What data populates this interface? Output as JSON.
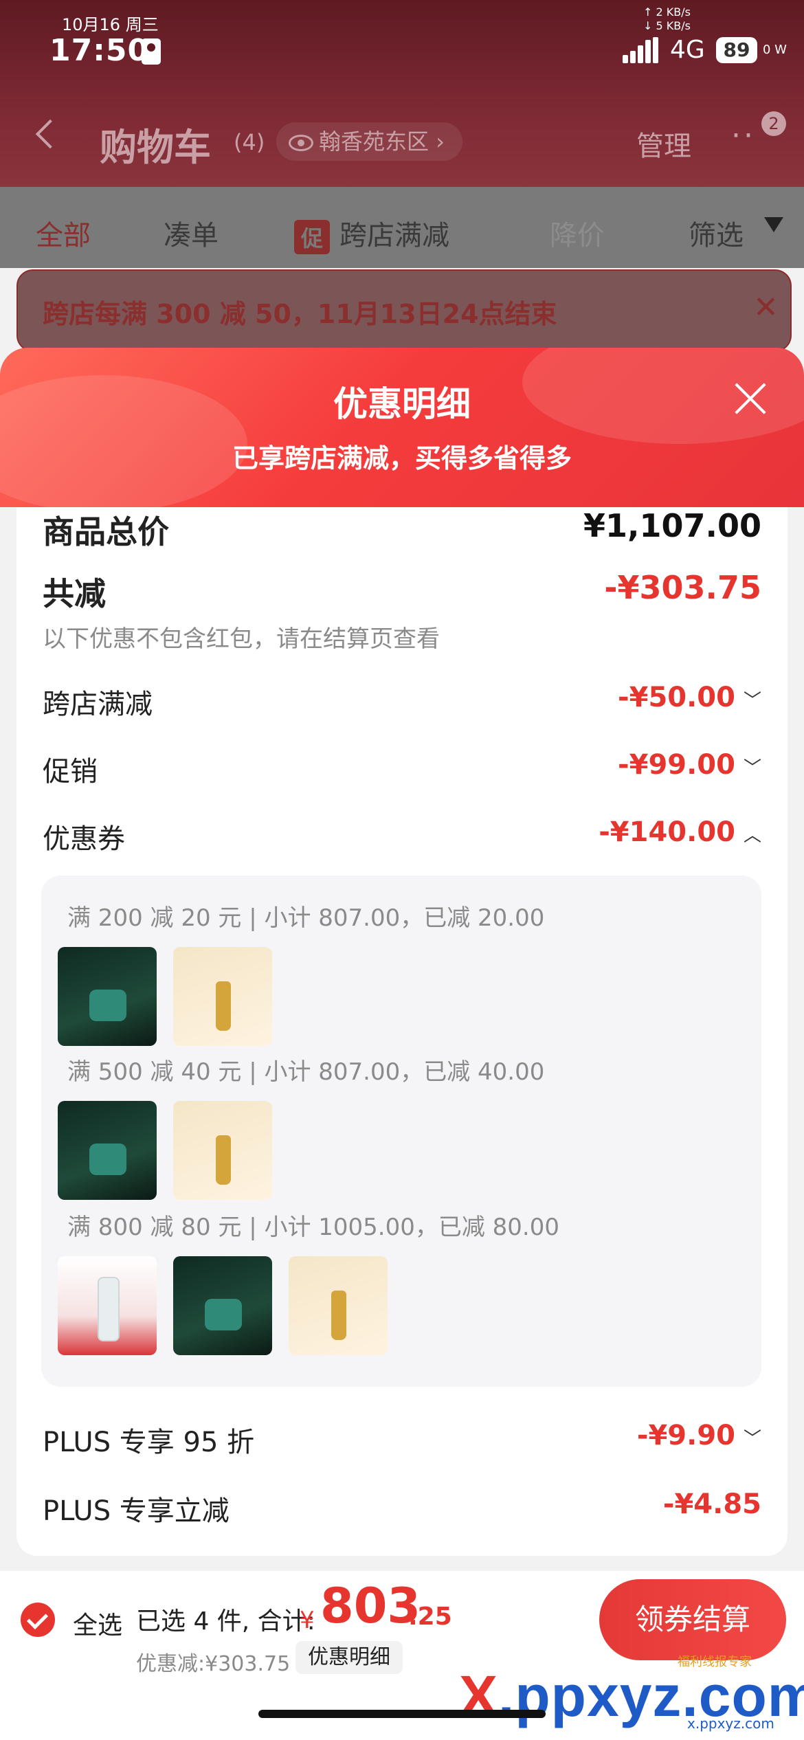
{
  "status_bar": {
    "date": "10月16 周三",
    "time": "17:50",
    "speed_up": "↑ 2 KB/s",
    "speed_down": "↓ 5 KB/s",
    "network": "4G",
    "battery": "89",
    "extra": "0 W"
  },
  "nav": {
    "title": "购物车",
    "count": "(4)",
    "location": "翰香苑东区",
    "manage": "管理",
    "badge": "2"
  },
  "tabs": {
    "all": "全部",
    "combine": "凑单",
    "promo_chip": "促",
    "cross_store": "跨店满减",
    "price_drop": "降价",
    "filter": "筛选"
  },
  "notice": {
    "text": "跨店每满 300 减 50，11月13日24点结束"
  },
  "sheet": {
    "title": "优惠明细",
    "subtitle": "已享跨店满减，买得多省得多",
    "total_label": "商品总价",
    "total_value": "¥1,107.00",
    "discount_label": "共减",
    "discount_value": "-¥303.75",
    "discount_note": "以下优惠不包含红包，请在结算页查看",
    "rows": [
      {
        "label": "跨店满减",
        "value": "-¥50.00"
      },
      {
        "label": "促销",
        "value": "-¥99.00"
      },
      {
        "label": "优惠券",
        "value": "-¥140.00"
      }
    ],
    "coupon_tiers": [
      {
        "text": "满 200 减 20 元 | 小计 807.00，已减 20.00"
      },
      {
        "text": "满 500 减 40 元 | 小计 807.00，已减 40.00"
      },
      {
        "text": "满 800 减 80 元 | 小计 1005.00，已减 80.00"
      }
    ],
    "plus_rows": [
      {
        "label": "PLUS 专享 95 折",
        "value": "-¥9.90"
      },
      {
        "label": "PLUS 专享立减",
        "value": "-¥4.85"
      }
    ]
  },
  "bottom": {
    "select_all": "全选",
    "selected_info": "已选 4 件, 合计:",
    "currency": "¥",
    "total_int": "803",
    "total_dec": ".25",
    "discount_line": "优惠减:¥303.75",
    "detail_chip": "优惠明细",
    "checkout": "领券结算"
  },
  "watermark": {
    "brand_x": "X",
    "brand_rest": ".ppxyz.com",
    "small": "福利线报专家",
    "url": "x.ppxyz.com"
  },
  "colors": {
    "accent": "#e6352f",
    "sheet_header": "#f53c3c"
  }
}
